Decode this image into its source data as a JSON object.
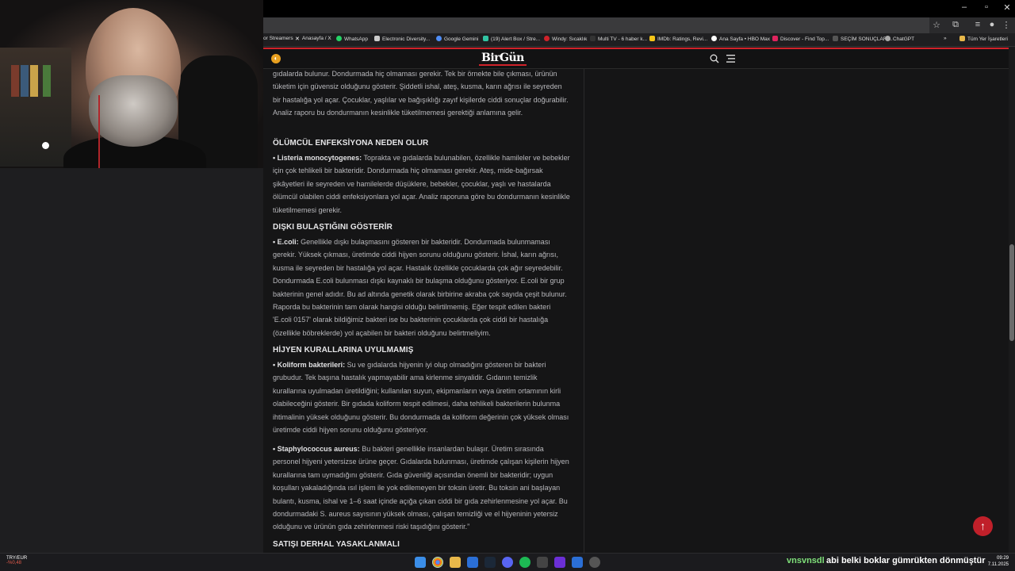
{
  "browser": {
    "address": "",
    "bookmarks": [
      {
        "label": "or Streamers",
        "color": "#9146ff"
      },
      {
        "label": "Anasayfa / X",
        "color": "#ffffff"
      },
      {
        "label": "WhatsApp",
        "color": "#25d366"
      },
      {
        "label": "Electronic Diversity...",
        "color": "#cccccc"
      },
      {
        "label": "Google Gemini",
        "color": "#4f8ef7"
      },
      {
        "label": "(19) Alert Box / Stre...",
        "color": "#31c3a2"
      },
      {
        "label": "Windy: Sıcaklık",
        "color": "#d0222a"
      },
      {
        "label": "Multi TV - 6 haber k...",
        "color": "#333333"
      },
      {
        "label": "IMDb: Ratings, Revi...",
        "color": "#f5c518"
      },
      {
        "label": "Ana Sayfa • HBO Max",
        "color": "#ffffff"
      },
      {
        "label": "Discover - Find Top...",
        "color": "#e0245e"
      },
      {
        "label": "SEÇİM SONUÇLARI...",
        "color": "#555555"
      },
      {
        "label": "ChatGPT",
        "color": "#aaaaaa"
      },
      {
        "label": "Tüm Yer İşaretleri",
        "color": "#e8b84a"
      }
    ]
  },
  "site": {
    "logo_a": "Bir",
    "logo_b": "Gün"
  },
  "article": {
    "p1": "gıdalarda bulunur. Dondurmada hiç olmaması gerekir. Tek bir örnekte bile çıkması, ürünün tüketim için güvensiz olduğunu gösterir. Şiddetli ishal, ateş, kusma, karın ağrısı ile seyreden bir hastalığa yol açar. Çocuklar, yaşlılar ve bağışıklığı zayıf kişilerde ciddi sonuçlar doğurabilir. Analiz raporu bu dondurmanın kesinlikle tüketilmemesi gerektiği anlamına gelir.",
    "h1": "ÖLÜMCÜL ENFEKSİYONA NEDEN OLUR",
    "p2_bold": "• Listeria monocytogenes:",
    "p2": " Toprakta ve gıdalarda bulunabilen, özellikle hamileler ve bebekler için çok tehlikeli bir bakteridir. Dondurmada hiç olmaması gerekir. Ateş, mide-bağırsak şikâyetleri ile seyreden ve hamilelerde düşüklere, bebekler, çocuklar, yaşlı ve hastalarda ölümcül olabilen ciddi enfeksiyonlara yol açar. Analiz raporuna göre bu dondurmanın kesinlikle tüketilmemesi gerekir.",
    "h2": "DIŞKI BULAŞTIĞINI GÖSTERİR",
    "p3_bold": "• E.coli:",
    "p3": " Genellikle dışkı bulaşmasını gösteren bir bakteridir. Dondurmada bulunmaması gerekir. Yüksek çıkması, üretimde ciddi hijyen sorunu olduğunu gösterir. İshal, karın ağrısı, kusma ile seyreden bir hastalığa yol açar. Hastalık özellikle çocuklarda çok ağır seyredebilir. Dondurmada E.coli bulunması dışkı kaynaklı bir bulaşma olduğunu gösteriyor. E.coli bir grup bakterinin genel adıdır. Bu ad altında genetik olarak birbirine akraba çok sayıda çeşit bulunur. Raporda bu bakterinin tam olarak hangisi olduğu belirtilmemiş. Eğer tespit edilen bakteri 'E.coli 0157' olarak bildiğimiz bakteri ise bu bakterinin çocuklarda çok ciddi bir hastalığa (özellikle böbreklerde) yol açabilen bir bakteri olduğunu belirtmeliyim.",
    "h3": "HİJYEN KURALLARINA UYULMAMIŞ",
    "p4_bold": "• Koliform bakterileri:",
    "p4": " Su ve gıdalarda hijyenin iyi olup olmadığını gösteren bir bakteri grubudur. Tek başına hastalık yapmayabilir ama kirlenme sinyalidir. Gıdanın temizlik kurallarına uyulmadan üretildiğini; kullanılan suyun, ekipmanların veya üretim ortamının kirli olabileceğini gösterir. Bir gıdada koliform tespit edilmesi, daha tehlikeli bakterilerin bulunma ihtimalinin yüksek olduğunu gösterir. Bu dondurmada da koliform değerinin çok yüksek olması üretimde ciddi hijyen sorunu olduğunu gösteriyor.",
    "p5_bold": "• Staphylococcus aureus:",
    "p5": " Bu bakteri genellikle insanlardan bulaşır. Üretim sırasında personel hijyeni yetersizse ürüne geçer. Gıdalarda bulunması, üretimde çalışan kişilerin hijyen kurallarına tam uymadığını gösterir. Gıda güvenliği açısından önemli bir bakteridir; uygun koşulları yakaladığında ısıl işlem ile yok edilemeyen bir toksin üretir. Bu toksin ani başlayan bulantı, kusma, ishal ve 1–6 saat içinde açığa çıkan ciddi bir gıda zehirlenmesine yol açar. Bu dondurmadaki S. aureus sayısının yüksek olması, çalışan temizliği ve el hijyeninin yetersiz olduğunu ve ürünün gıda zehirlenmesi riski taşıdığını gösterir.”",
    "h4": "SATIŞI DERHAL YASAKLANMALI"
  },
  "taskbar": {
    "currency": "TRY/EUR",
    "currency_change": "-%0,48",
    "chat_user": "vnsvnsdl",
    "chat_message": "abi belki boklar gümrükten dönmüştür",
    "time": "09:29",
    "date": "7.11.2025"
  },
  "colors": {
    "accent": "#d0222a",
    "page_bg": "#151516"
  }
}
